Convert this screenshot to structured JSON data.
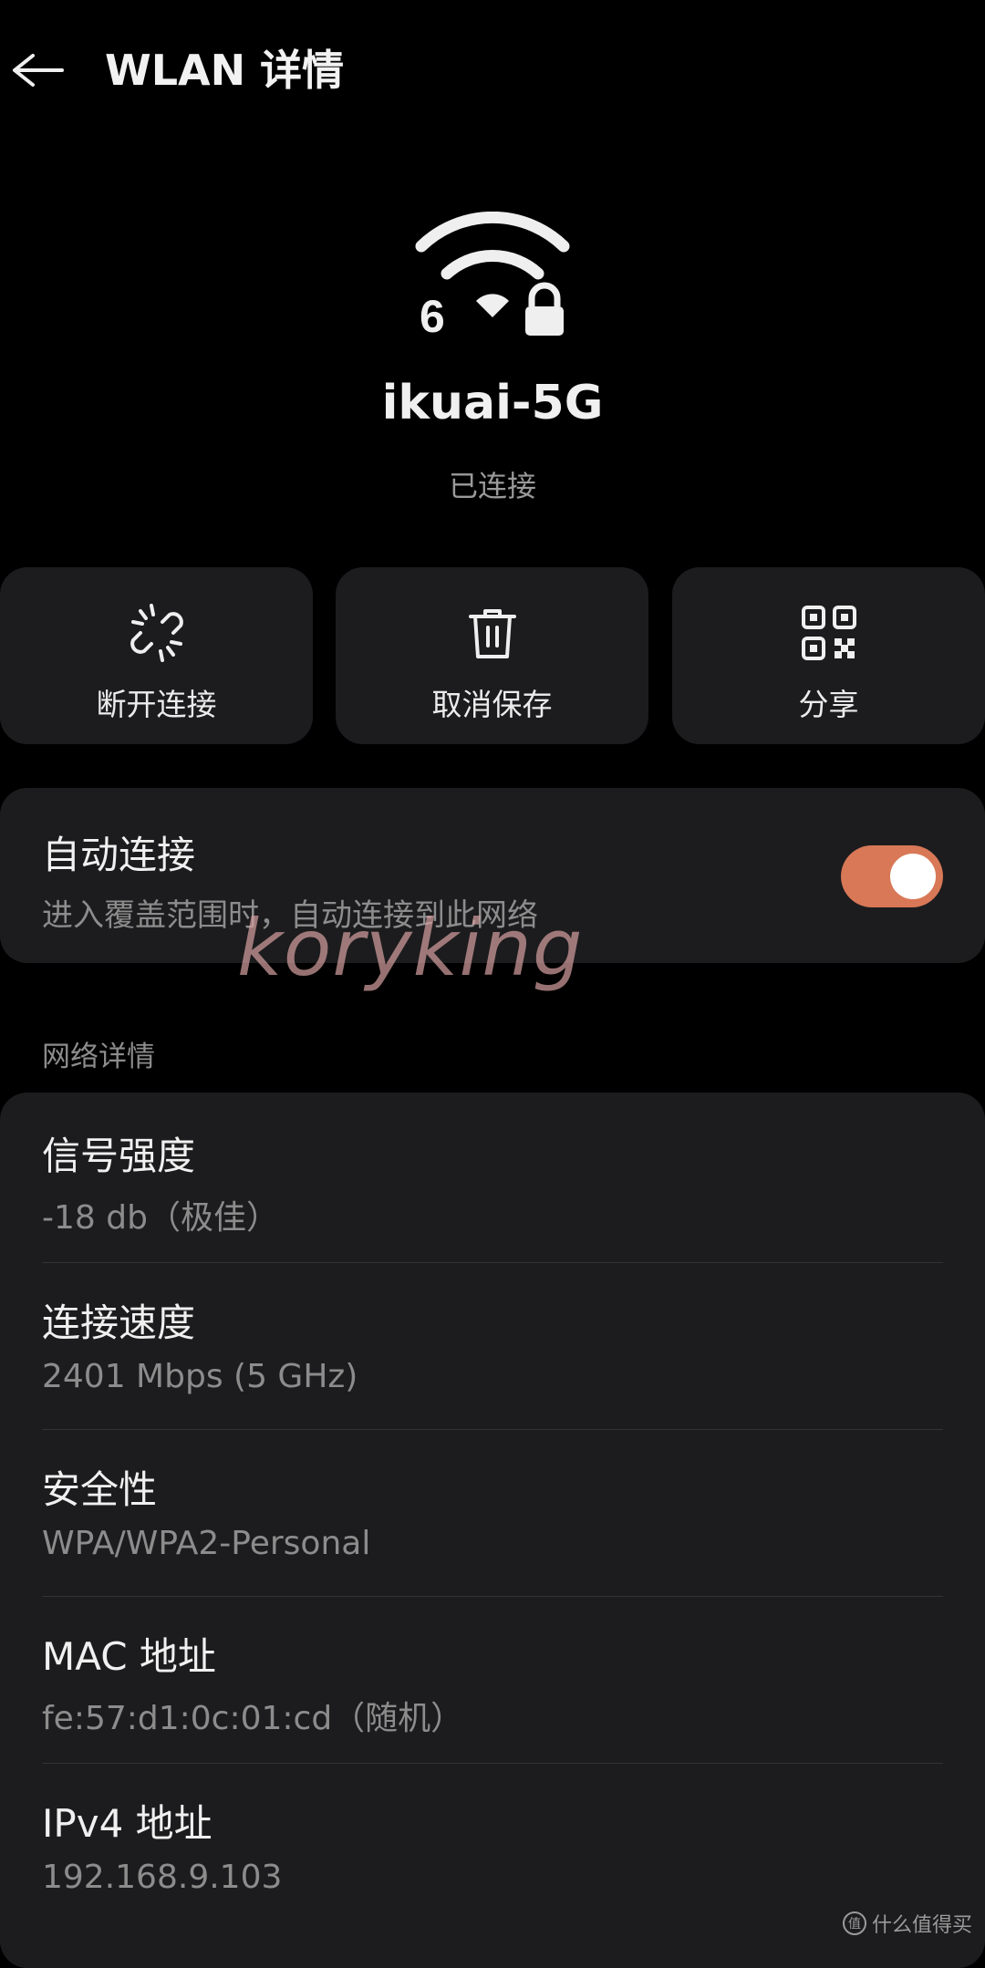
{
  "header": {
    "title": "WLAN 详情"
  },
  "network": {
    "band_badge": "6",
    "ssid": "ikuai-5G",
    "status": "已连接"
  },
  "actions": [
    {
      "label": "断开连接",
      "icon": "disconnect-link-icon"
    },
    {
      "label": "取消保存",
      "icon": "trash-icon"
    },
    {
      "label": "分享",
      "icon": "qr-code-icon"
    }
  ],
  "auto_connect": {
    "title": "自动连接",
    "subtitle": "进入覆盖范围时，自动连接到此网络",
    "enabled": true,
    "accent_color": "#d87857"
  },
  "watermark": "koryking",
  "details_section": {
    "title": "网络详情",
    "rows": [
      {
        "label": "信号强度",
        "value": "-18 db（极佳）"
      },
      {
        "label": "连接速度",
        "value": "2401 Mbps (5 GHz)"
      },
      {
        "label": "安全性",
        "value": "WPA/WPA2-Personal"
      },
      {
        "label": "MAC 地址",
        "value": "fe:57:d1:0c:01:cd（随机）"
      },
      {
        "label": "IPv4 地址",
        "value": "192.168.9.103"
      }
    ]
  },
  "footer_mark": {
    "symbol": "值",
    "text": "什么值得买"
  }
}
